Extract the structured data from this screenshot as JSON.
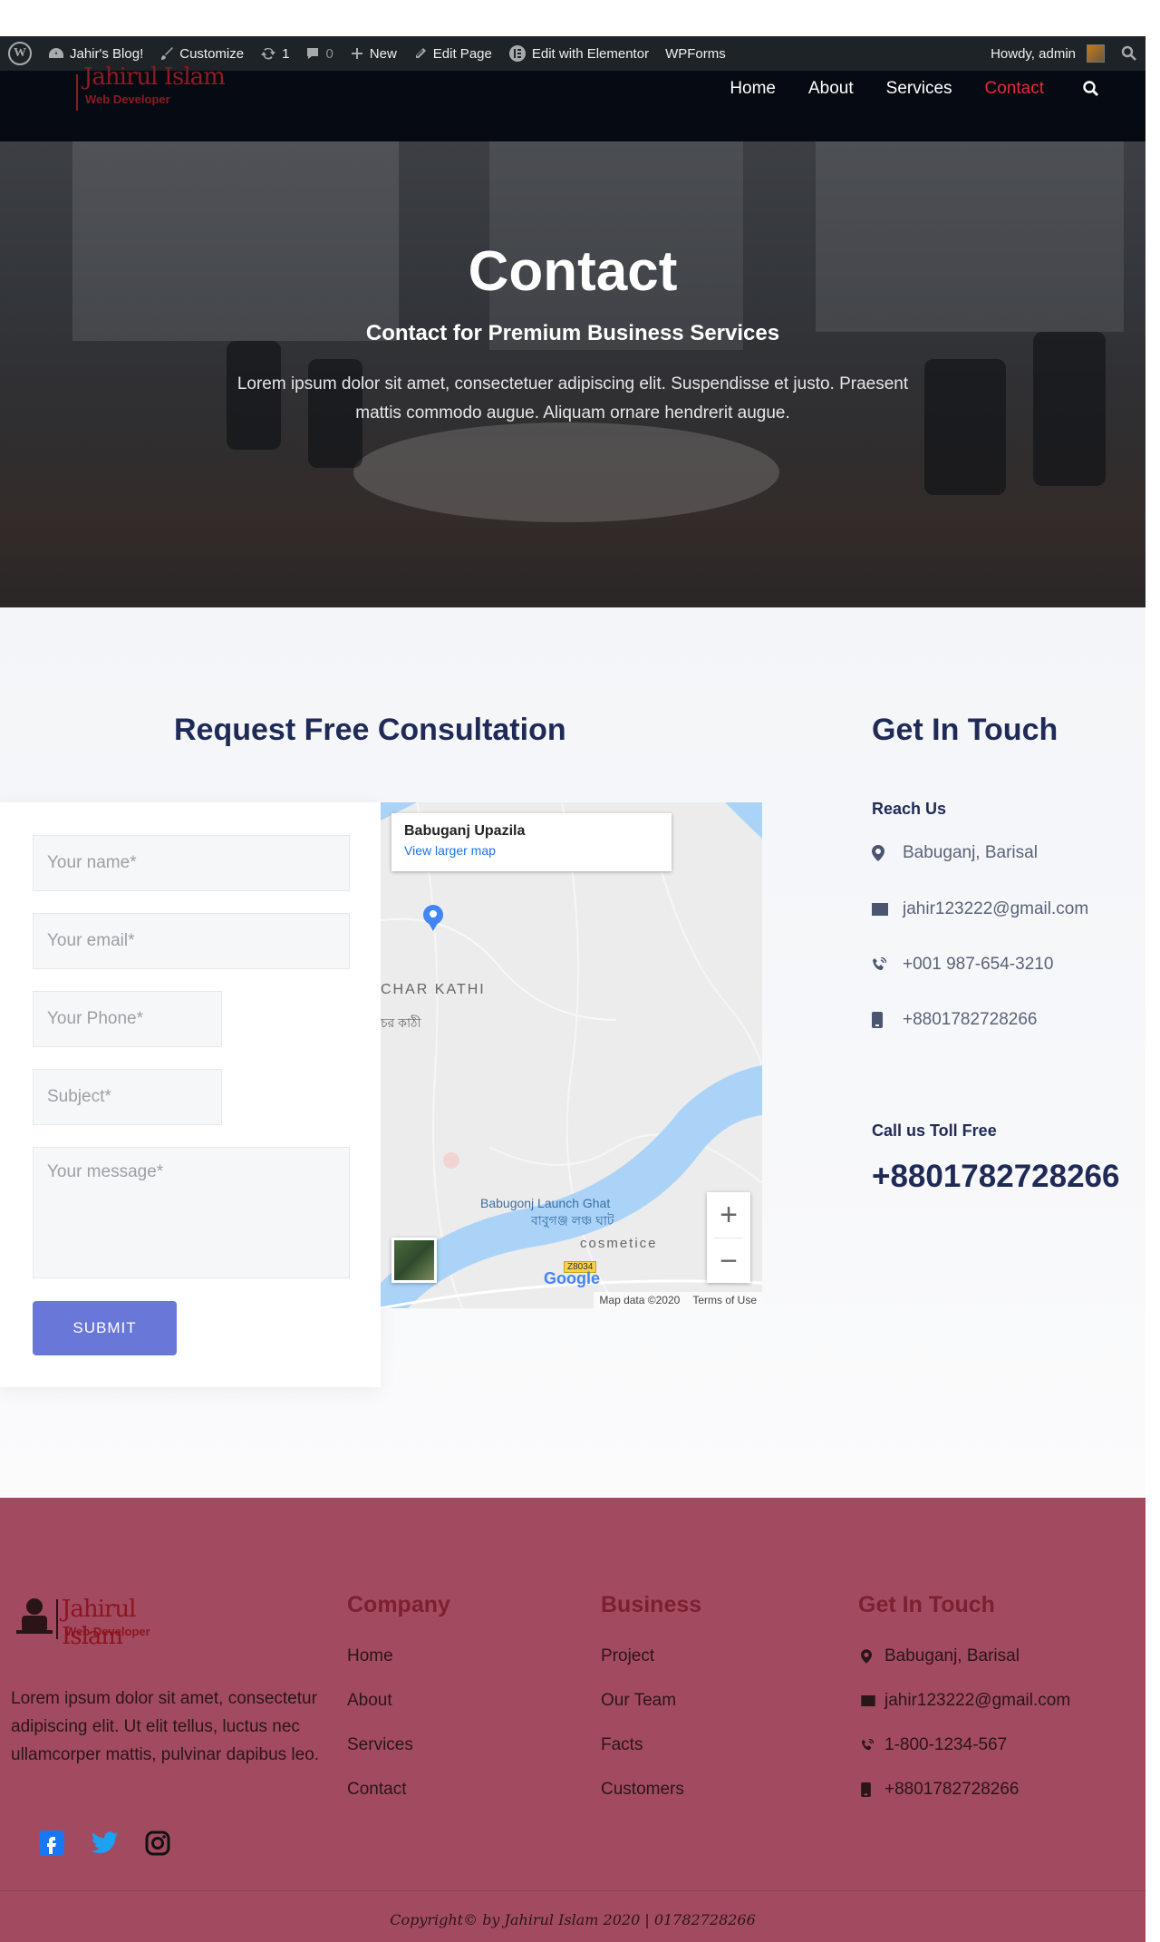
{
  "adminbar": {
    "site_name": "Jahir's Blog!",
    "customize": "Customize",
    "updates_count": "1",
    "comments_count": "0",
    "new_label": "New",
    "edit_page": "Edit Page",
    "edit_elementor": "Edit with Elementor",
    "wpforms": "WPForms",
    "howdy": "Howdy, admin"
  },
  "header": {
    "logo_name": "Jahirul Islam",
    "logo_sub": "Web Developer",
    "nav": [
      "Home",
      "About",
      "Services",
      "Contact"
    ],
    "active_nav": "Contact"
  },
  "hero": {
    "title": "Contact",
    "subtitle": "Contact for Premium Business Services",
    "text": "Lorem ipsum dolor sit amet, consectetuer adipiscing elit. Suspendisse et justo. Praesent mattis commodo augue. Aliquam ornare hendrerit augue."
  },
  "consultation": {
    "title": "Request Free Consultation",
    "placeholders": {
      "name": "Your name*",
      "email": "Your email*",
      "phone": "Your Phone*",
      "subject": "Subject*",
      "message": "Your message*"
    },
    "submit_label": "SUBMIT"
  },
  "map": {
    "place_title": "Babuganj Upazila",
    "larger_map": "View larger map",
    "char_kathi": "CHAR KATHI",
    "char_kathi_bn": "চর কাঠী",
    "launch_ghat": "Babugonj Launch Ghat",
    "launch_ghat_bn": "বাবুগঞ্জ লঞ্চ ঘাট",
    "cosmetice": "cosmetice",
    "road_badge": "Z8034",
    "google": "Google",
    "map_data": "Map data ©2020",
    "terms": "Terms of Use",
    "zoom_in": "+",
    "zoom_out": "−"
  },
  "get_in_touch": {
    "title": "Get In Touch",
    "reach_us": "Reach Us",
    "address": "Babuganj, Barisal",
    "email": "jahir123222@gmail.com",
    "phone": "+001 987-654-3210",
    "mobile": "+8801782728266",
    "toll_free_label": "Call us Toll Free",
    "toll_free_number": "+8801782728266"
  },
  "footer": {
    "logo_name": "Jahirul Islam",
    "logo_sub": "Web Developer",
    "description": "Lorem ipsum dolor sit amet, consectetur adipiscing elit. Ut elit tellus, luctus nec ullamcorper mattis, pulvinar dapibus leo.",
    "company_title": "Company",
    "company_links": [
      "Home",
      "About",
      "Services",
      "Contact"
    ],
    "business_title": "Business",
    "business_links": [
      "Project",
      "Our Team",
      "Facts",
      "Customers"
    ],
    "contact_title": "Get In Touch",
    "contact_address": "Babuganj, Barisal",
    "contact_email": "jahir123222@gmail.com",
    "contact_phone": "1-800-1234-567",
    "contact_mobile": "+8801782728266",
    "copyright": "Copyright© by Jahirul Islam 2020 | 01782728266"
  },
  "colors": {
    "accent_nav_active": "#e8293a",
    "button": "#6877d8",
    "heading": "#1f2a56",
    "footer_bg": "#a24b60"
  }
}
